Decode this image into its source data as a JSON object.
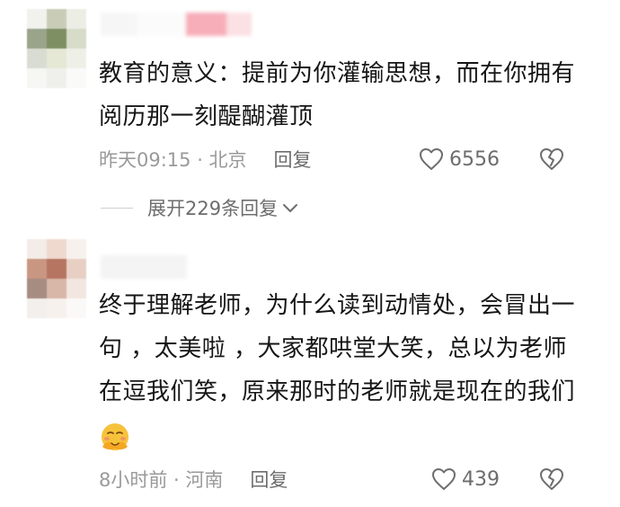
{
  "comments": [
    {
      "text": "教育的意义：提前为你灌输思想，而在你拥有阅历那一刻醍醐灌顶",
      "time_location": "昨天09:15 · 北京",
      "reply_label": "回复",
      "like_count": "6556",
      "expand_label": "展开229条回复"
    },
    {
      "text": "终于理解老师，为什么读到动情处，会冒出一句 ，太美啦 ，大家都哄堂大笑，总以为老师在逗我们笑，原来那时的老师就是现在的我们",
      "emoji": "face-with-open-hands-emoji",
      "time_location": "8小时前 · 河南",
      "reply_label": "回复",
      "like_count": "439"
    }
  ],
  "icons": {
    "like": "heart-outline-icon",
    "dislike": "broken-heart-outline-icon",
    "expand": "chevron-down-icon"
  },
  "colors": {
    "text": "#161616",
    "meta": "#9a9a9a",
    "action": "#6d6d6d",
    "emoji_yellow": "#f7c23b",
    "emoji_blush": "#f08a6a"
  }
}
